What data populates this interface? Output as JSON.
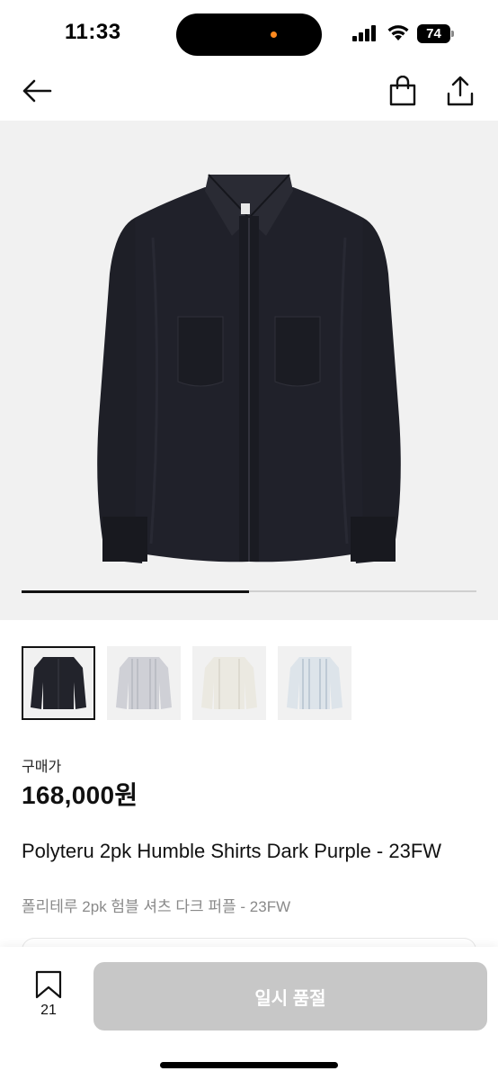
{
  "status_bar": {
    "time": "11:33",
    "battery": "74"
  },
  "nav": {
    "back_icon": "arrow-left-icon",
    "bag_icon": "shopping-bag-icon",
    "share_icon": "share-icon"
  },
  "gallery": {
    "image_count": 4,
    "current_index": 1,
    "progress_fraction": 0.5
  },
  "price": {
    "label": "구매가",
    "value": "168,000원"
  },
  "product": {
    "title_en": "Polyteru 2pk Humble Shirts Dark Purple - 23FW",
    "title_ko": "폴리테루 2pk 험블 셔츠 다크 퍼플 - 23FW"
  },
  "bottom": {
    "bookmark_count": "21",
    "soldout_label": "일시 품절"
  },
  "colors": {
    "shirt_main": "#1f2028",
    "button_disabled": "#c7c7c7",
    "background_gray": "#f1f1f1"
  }
}
